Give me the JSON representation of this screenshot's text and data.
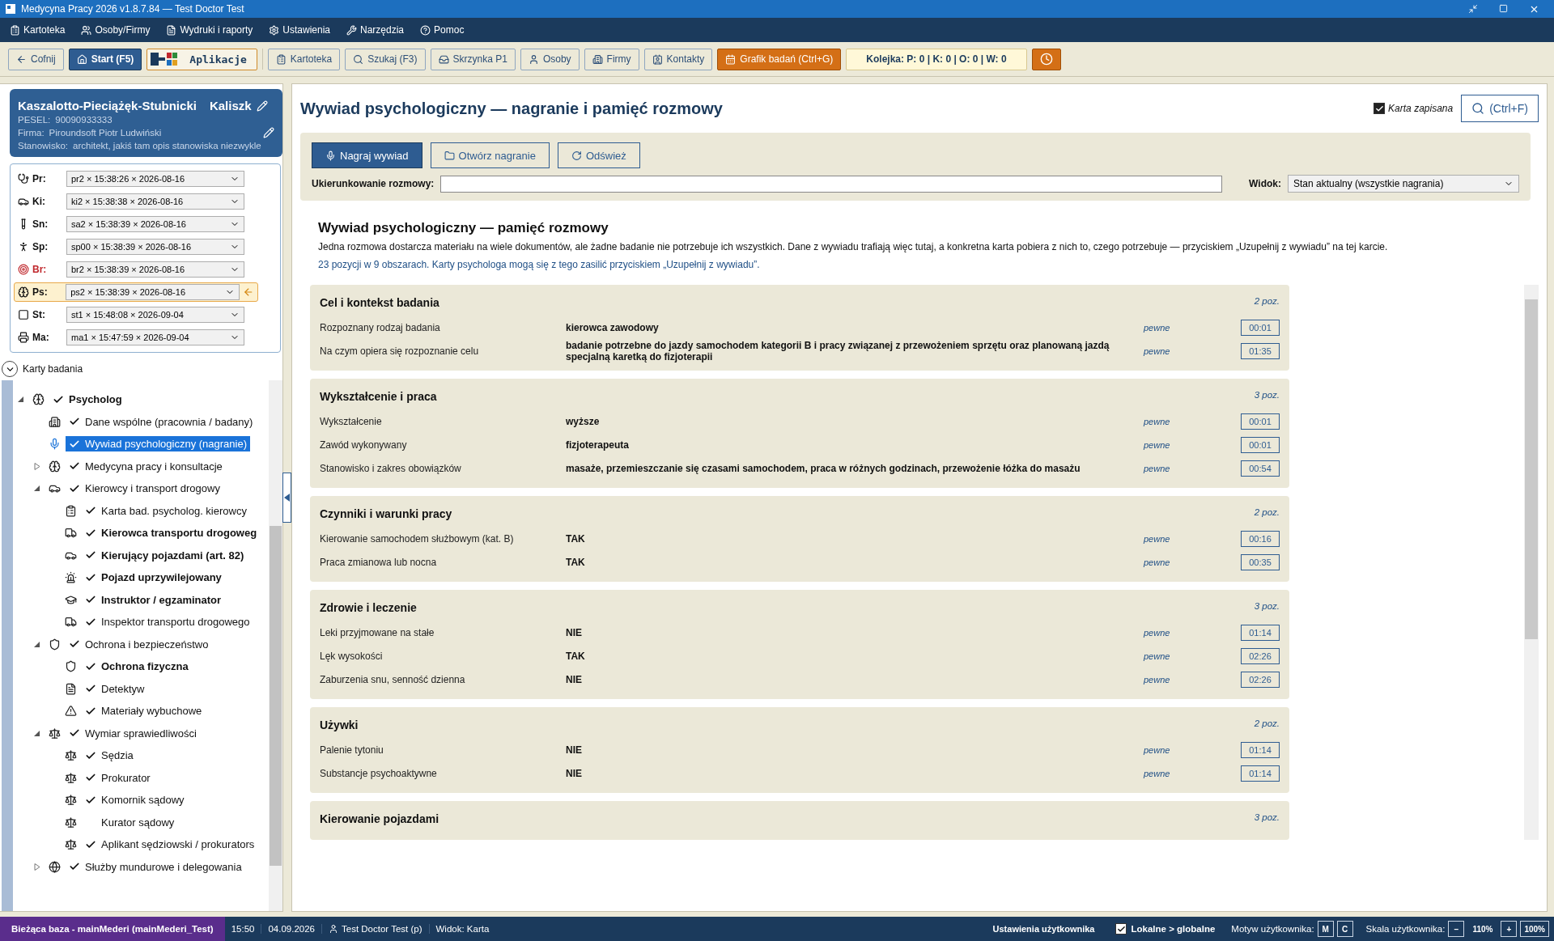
{
  "window": {
    "title": "Medycyna Pracy 2026 v1.8.7.84 — Test Doctor Test"
  },
  "menu": [
    "Kartoteka",
    "Osoby/Firmy",
    "Wydruki i raporty",
    "Ustawienia",
    "Narzędzia",
    "Pomoc"
  ],
  "toolbar": [
    {
      "kind": "plain",
      "label": "Cofnij"
    },
    {
      "kind": "primary",
      "label": "Start (F5)"
    },
    {
      "kind": "apps",
      "label": "Aplikacje"
    },
    {
      "kind": "plain",
      "label": "Kartoteka"
    },
    {
      "kind": "plain",
      "label": "Szukaj (F3)"
    },
    {
      "kind": "plain",
      "label": "Skrzynka P1"
    },
    {
      "kind": "plain",
      "label": "Osoby"
    },
    {
      "kind": "plain",
      "label": "Firmy"
    },
    {
      "kind": "plain",
      "label": "Kontakty"
    },
    {
      "kind": "accent",
      "label": "Grafik badań (Ctrl+G)"
    },
    {
      "kind": "queue",
      "label": "Kolejka: P: 0 | K: 0 | O: 0 | W: 0"
    },
    {
      "kind": "clock"
    }
  ],
  "patient": {
    "name": "Kaszalotto-Pieciążęk-Stubnicki",
    "first_name": "Kaliszk",
    "pesel_label": "PESEL:",
    "pesel": "90090933333",
    "firm_label": "Firma:",
    "firm": "Piroundsoft  Piotr Ludwiński",
    "position_label": "Stanowisko:",
    "position": "architekt, jakiś tam opis stanowiska niezwykle"
  },
  "exams": [
    {
      "label": "Pr:",
      "value": "pr2 × 15:38:26 × 2026-08-16",
      "alert": false,
      "selected": false
    },
    {
      "label": "Ki:",
      "value": "ki2 × 15:38:38 × 2026-08-16",
      "alert": false,
      "selected": false
    },
    {
      "label": "Sn:",
      "value": "sa2 × 15:38:39 × 2026-08-16",
      "alert": false,
      "selected": false
    },
    {
      "label": "Sp:",
      "value": "sp00 × 15:38:39 × 2026-08-16",
      "alert": false,
      "selected": false
    },
    {
      "label": "Br:",
      "value": "br2 × 15:38:39 × 2026-08-16",
      "alert": true,
      "selected": false
    },
    {
      "label": "Ps:",
      "value": "ps2 × 15:38:39 × 2026-08-16",
      "alert": false,
      "selected": true
    },
    {
      "label": "St:",
      "value": "st1 × 15:48:08 × 2026-09-04",
      "alert": false,
      "selected": false
    },
    {
      "label": "Ma:",
      "value": "ma1 × 15:47:59 × 2026-09-04",
      "alert": false,
      "selected": false
    }
  ],
  "cards_header": {
    "label": "Karty badania",
    "expanded": true
  },
  "tree": [
    {
      "label": "Psycholog",
      "checked": true,
      "bold": true,
      "selected": false,
      "expanded": true,
      "children": [
        {
          "label": "Dane wspólne (pracownia / badany)",
          "checked": true,
          "bold": false,
          "selected": false
        },
        {
          "label": "Wywiad psychologiczny (nagranie)",
          "checked": true,
          "bold": false,
          "selected": true
        },
        {
          "label": "Medycyna pracy i konsultacje",
          "checked": true,
          "bold": false,
          "selected": false,
          "expanded": false
        },
        {
          "label": "Kierowcy i transport drogowy",
          "checked": true,
          "bold": false,
          "selected": false,
          "expanded": true,
          "children": [
            {
              "label": "Karta bad. psycholog. kierowcy",
              "checked": true,
              "bold": false,
              "selected": false
            },
            {
              "label": "Kierowca transportu drogoweg",
              "checked": true,
              "bold": true,
              "selected": false
            },
            {
              "label": "Kierujący pojazdami (art. 82)",
              "checked": true,
              "bold": true,
              "selected": false
            },
            {
              "label": "Pojazd uprzywilejowany",
              "checked": true,
              "bold": true,
              "selected": false
            },
            {
              "label": "Instruktor / egzaminator",
              "checked": true,
              "bold": true,
              "selected": false
            },
            {
              "label": "Inspektor transportu drogowego",
              "checked": true,
              "bold": false,
              "selected": false
            }
          ]
        },
        {
          "label": "Ochrona i bezpieczeństwo",
          "checked": true,
          "bold": false,
          "selected": false,
          "expanded": true,
          "children": [
            {
              "label": "Ochrona fizyczna",
              "checked": true,
              "bold": true,
              "selected": false
            },
            {
              "label": "Detektyw",
              "checked": true,
              "bold": false,
              "selected": false
            },
            {
              "label": "Materiały wybuchowe",
              "checked": true,
              "bold": false,
              "selected": false
            }
          ]
        },
        {
          "label": "Wymiar sprawiedliwości",
          "checked": true,
          "bold": false,
          "selected": false,
          "expanded": true,
          "children": [
            {
              "label": "Sędzia",
              "checked": true,
              "bold": false,
              "selected": false
            },
            {
              "label": "Prokurator",
              "checked": true,
              "bold": false,
              "selected": false
            },
            {
              "label": "Komornik sądowy",
              "checked": true,
              "bold": false,
              "selected": false
            },
            {
              "label": "Kurator sądowy",
              "checked": false,
              "bold": false,
              "selected": false
            },
            {
              "label": "Aplikant sędziowski / prokurators",
              "checked": true,
              "bold": false,
              "selected": false
            }
          ]
        },
        {
          "label": "Służby mundurowe i delegowania",
          "checked": true,
          "bold": false,
          "selected": false,
          "expanded": false
        }
      ]
    }
  ],
  "content": {
    "title": "Wywiad psychologiczny — nagranie i pamięć rozmowy",
    "saved": {
      "label": "Karta zapisana",
      "checked": true
    },
    "search_button": "(Ctrl+F)",
    "actions": [
      {
        "kind": "primary",
        "label": "Nagraj wywiad"
      },
      {
        "kind": "plain",
        "label": "Otwórz nagranie"
      },
      {
        "kind": "plain",
        "label": "Odśwież"
      }
    ],
    "direction_label": "Ukierunkowanie rozmowy:",
    "view_label": "Widok:",
    "view_value": "Stan aktualny (wszystkie nagrania)",
    "memory_title": "Wywiad psychologiczny — pamięć rozmowy",
    "memory_text": "Jedna rozmowa dostarcza materiału na wiele dokumentów, ale żadne badanie nie potrzebuje ich wszystkich. Dane z wywiadu trafiają więc tutaj, a konkretna karta pobiera z nich to, czego potrzebuje — przyciskiem „Uzupełnij z wywiadu” na tej karcie.",
    "memory_summary": "23 pozycji w 9 obszarach. Karty psychologa mogą się z tego zasilić przyciskiem „Uzupełnij z wywiadu”.",
    "sections": [
      {
        "title": "Cel i kontekst badania",
        "count": "2 poz.",
        "rows": [
          {
            "label": "Rozpoznany rodzaj badania",
            "value": "kierowca zawodowy",
            "certainty": "pewne",
            "time": "00:01"
          },
          {
            "label": "Na czym opiera się rozpoznanie celu",
            "value": "badanie potrzebne do jazdy samochodem kategorii B i pracy związanej z przewożeniem sprzętu oraz planowaną jazdą specjalną karetką do fizjoterapii",
            "certainty": "pewne",
            "time": "01:35"
          }
        ]
      },
      {
        "title": "Wykształcenie i praca",
        "count": "3 poz.",
        "rows": [
          {
            "label": "Wykształcenie",
            "value": "wyższe",
            "certainty": "pewne",
            "time": "00:01"
          },
          {
            "label": "Zawód wykonywany",
            "value": "fizjoterapeuta",
            "certainty": "pewne",
            "time": "00:01"
          },
          {
            "label": "Stanowisko i zakres obowiązków",
            "value": "masaże, przemieszczanie się czasami samochodem, praca w różnych godzinach, przewożenie łóżka do masażu",
            "certainty": "pewne",
            "time": "00:54"
          }
        ]
      },
      {
        "title": "Czynniki i warunki pracy",
        "count": "2 poz.",
        "rows": [
          {
            "label": "Kierowanie samochodem służbowym (kat. B)",
            "value": "TAK",
            "certainty": "pewne",
            "time": "00:16"
          },
          {
            "label": "Praca zmianowa lub nocna",
            "value": "TAK",
            "certainty": "pewne",
            "time": "00:35"
          }
        ]
      },
      {
        "title": "Zdrowie i leczenie",
        "count": "3 poz.",
        "rows": [
          {
            "label": "Leki przyjmowane na stałe",
            "value": "NIE",
            "certainty": "pewne",
            "time": "01:14"
          },
          {
            "label": "Lęk wysokości",
            "value": "TAK",
            "certainty": "pewne",
            "time": "02:26"
          },
          {
            "label": "Zaburzenia snu, senność dzienna",
            "value": "NIE",
            "certainty": "pewne",
            "time": "02:26"
          }
        ]
      },
      {
        "title": "Używki",
        "count": "2 poz.",
        "rows": [
          {
            "label": "Palenie tytoniu",
            "value": "NIE",
            "certainty": "pewne",
            "time": "01:14"
          },
          {
            "label": "Substancje psychoaktywne",
            "value": "NIE",
            "certainty": "pewne",
            "time": "01:14"
          }
        ]
      },
      {
        "title": "Kierowanie pojazdami",
        "count": "3 poz."
      }
    ]
  },
  "status_bar": {
    "database": "Bieżąca baza - mainMederi (mainMederi_Test)",
    "time": "15:50",
    "date": "04.09.2026",
    "user": "Test Doctor Test (p)",
    "view": "Widok: Karta",
    "settings": "Ustawienia użytkownika",
    "local_global": {
      "label": "Lokalne > globalne",
      "checked": true
    },
    "theme_label": "Motyw użytkownika:",
    "themes": [
      {
        "label": "M",
        "selected": false
      },
      {
        "label": "C",
        "selected": false
      }
    ],
    "scale_label": "Skala użytkownika:",
    "scale_minus": "–",
    "scale_value": "110%",
    "scale_plus": "+",
    "scale_reset": "100%"
  }
}
